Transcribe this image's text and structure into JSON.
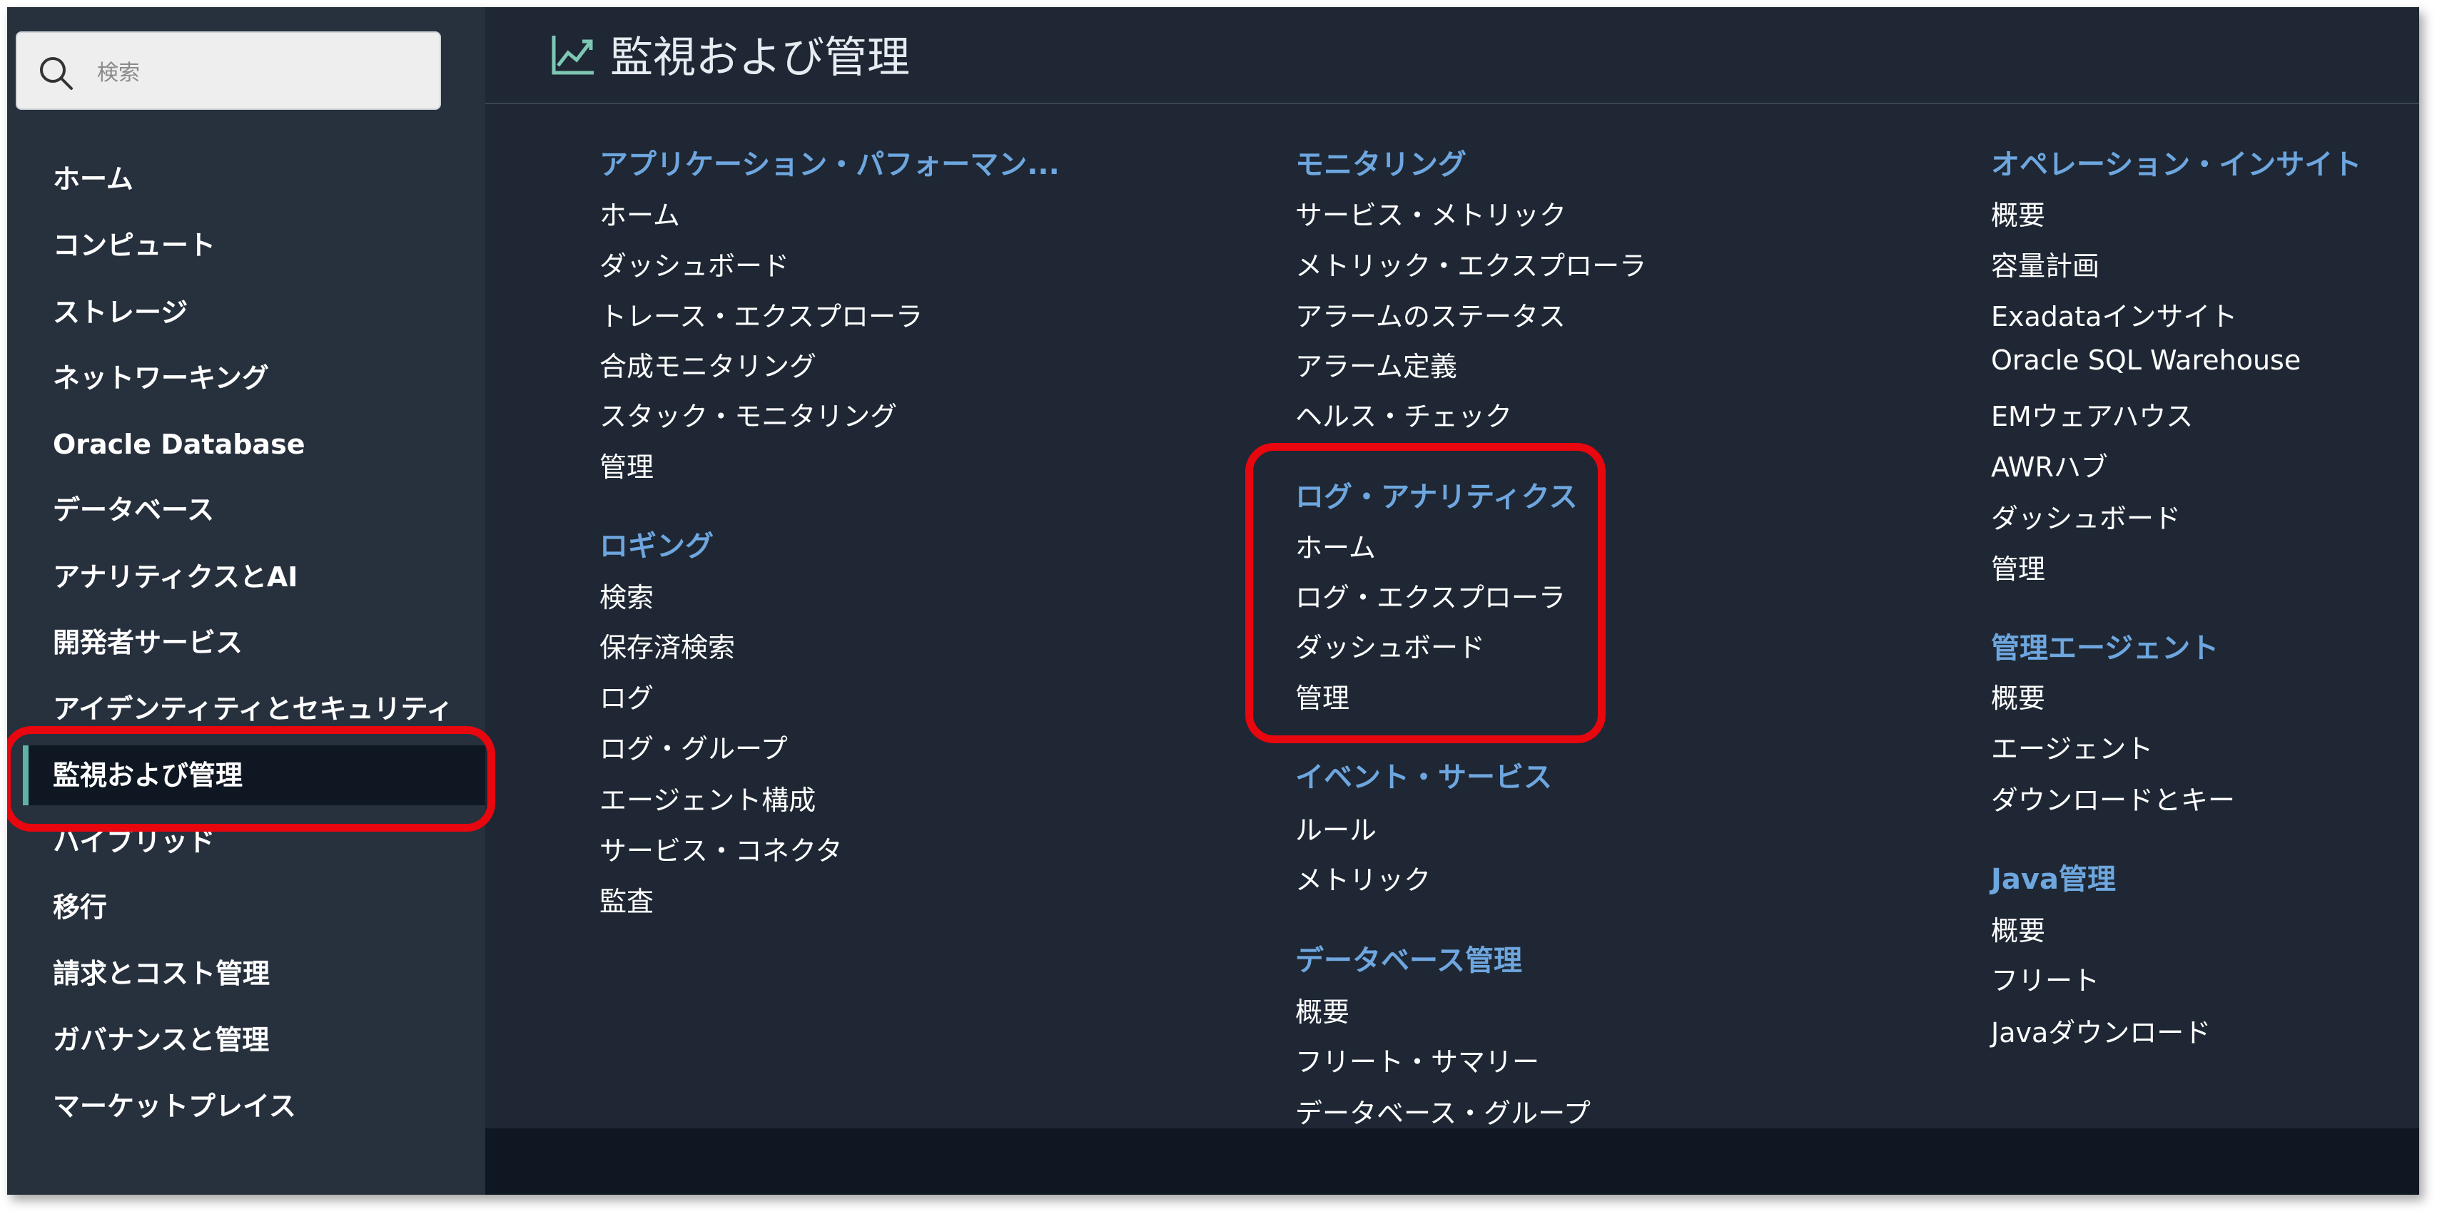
{
  "search": {
    "placeholder": "検索"
  },
  "sidebar": {
    "items": [
      {
        "label": "ホーム"
      },
      {
        "label": "コンピュート"
      },
      {
        "label": "ストレージ"
      },
      {
        "label": "ネットワーキング"
      },
      {
        "label": "Oracle Database"
      },
      {
        "label": "データベース"
      },
      {
        "label": "アナリティクスとAI"
      },
      {
        "label": "開発者サービス"
      },
      {
        "label": "アイデンティティとセキュリティ"
      },
      {
        "label": "監視および管理",
        "active": true
      },
      {
        "label": "ハイブリッド"
      },
      {
        "label": "移行"
      },
      {
        "label": "請求とコスト管理"
      },
      {
        "label": "ガバナンスと管理"
      },
      {
        "label": "マーケットプレイス"
      }
    ]
  },
  "main": {
    "title": "監視および管理",
    "title_icon": "chart-line-icon",
    "columns": [
      {
        "sections": [
          {
            "heading": "アプリケーション・パフォーマン...",
            "links": [
              "ホーム",
              "ダッシュボード",
              "トレース・エクスプローラ",
              "合成モニタリング",
              "スタック・モニタリング",
              "管理"
            ]
          },
          {
            "heading": "ロギング",
            "links": [
              "検索",
              "保存済検索",
              "ログ",
              "ログ・グループ",
              "エージェント構成",
              "サービス・コネクタ",
              "監査"
            ]
          }
        ]
      },
      {
        "sections": [
          {
            "heading": "モニタリング",
            "links": [
              "サービス・メトリック",
              "メトリック・エクスプローラ",
              "アラームのステータス",
              "アラーム定義",
              "ヘルス・チェック"
            ]
          },
          {
            "heading": "ログ・アナリティクス",
            "links": [
              "ホーム",
              "ログ・エクスプローラ",
              "ダッシュボード",
              "管理"
            ]
          },
          {
            "heading": "イベント・サービス",
            "links": [
              "ルール",
              "メトリック"
            ]
          },
          {
            "heading": "データベース管理",
            "links": [
              "概要",
              "フリート・サマリー",
              "データベース・グループ"
            ]
          }
        ]
      },
      {
        "sections": [
          {
            "heading": "オペレーション・インサイト",
            "links": [
              "概要",
              "容量計画",
              "Exadataインサイト",
              "Oracle SQL Warehouse",
              "EMウェアハウス",
              "AWRハブ",
              "ダッシュボード",
              "管理"
            ]
          },
          {
            "heading": "管理エージェント",
            "links": [
              "概要",
              "エージェント",
              "ダウンロードとキー"
            ]
          },
          {
            "heading": "Java管理",
            "links": [
              "概要",
              "フリート",
              "Javaダウンロード"
            ]
          }
        ]
      }
    ]
  },
  "colors": {
    "background": "#1e2733",
    "sidebar": "#27303d",
    "heading": "#6ea6df",
    "active_bar": "#5fb3a4",
    "highlight": "#e8060f"
  }
}
